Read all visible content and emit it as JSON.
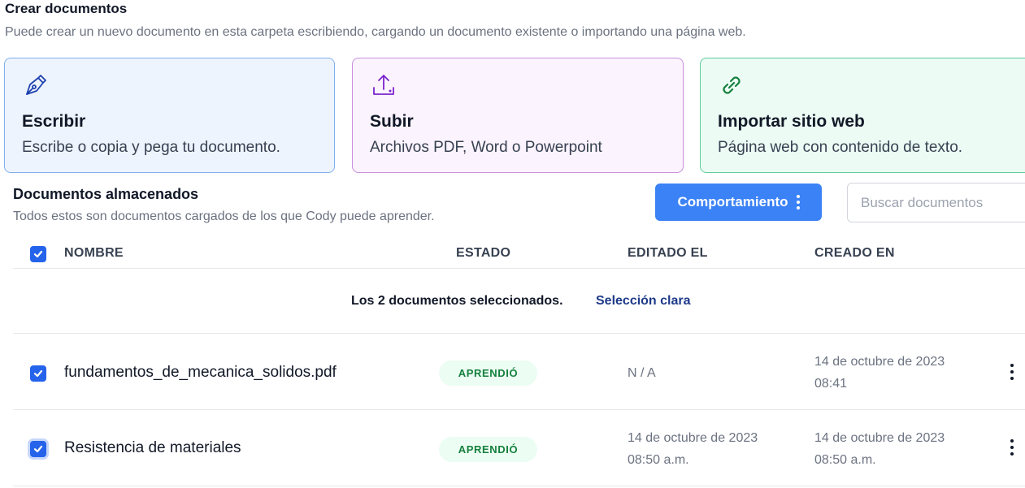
{
  "header": {
    "title": "Crear documentos",
    "subtitle": "Puede crear un nuevo documento en esta carpeta escribiendo, cargando un documento existente o importando una página web."
  },
  "cards": [
    {
      "title": "Escribir",
      "desc": "Escribe o copia y pega tu documento.",
      "icon": "pen-nib-icon",
      "color": "#2563eb"
    },
    {
      "title": "Subir",
      "desc": "Archivos PDF, Word o Powerpoint",
      "icon": "upload-icon",
      "color": "#7e22ce"
    },
    {
      "title": "Importar sitio web",
      "desc": "Página web con contenido de texto.",
      "icon": "link-icon",
      "color": "#15803d"
    }
  ],
  "stored": {
    "title": "Documentos almacenados",
    "subtitle": "Todos estos son documentos cargados de los que Cody puede aprender."
  },
  "behavior_button": {
    "label": "Comportamiento"
  },
  "search": {
    "placeholder": "Buscar documentos",
    "value": ""
  },
  "table": {
    "headers": {
      "name": "NOMBRE",
      "status": "ESTADO",
      "edited": "EDITADO EL",
      "created": "CREADO EN"
    },
    "selection_text": "Los 2 documentos seleccionados.",
    "clear_selection": "Selección clara",
    "rows": [
      {
        "name": "fundamentos_de_mecanica_solidos.pdf",
        "status": "APRENDIÓ",
        "edited_line1": "N / A",
        "edited_line2": "",
        "created_line1": "14 de octubre de 2023",
        "created_line2": "08:41",
        "checked": true
      },
      {
        "name": "Resistencia de materiales",
        "status": "APRENDIÓ",
        "edited_line1": "14 de octubre de 2023",
        "edited_line2": "08:50 a.m.",
        "created_line1": "14 de octubre de 2023",
        "created_line2": "08:50 a.m.",
        "checked": true
      }
    ]
  },
  "colors": {
    "accent": "#3b82f6",
    "checkbox": "#2563eb",
    "badge_bg": "#ecfdf3",
    "badge_text": "#15803d"
  }
}
